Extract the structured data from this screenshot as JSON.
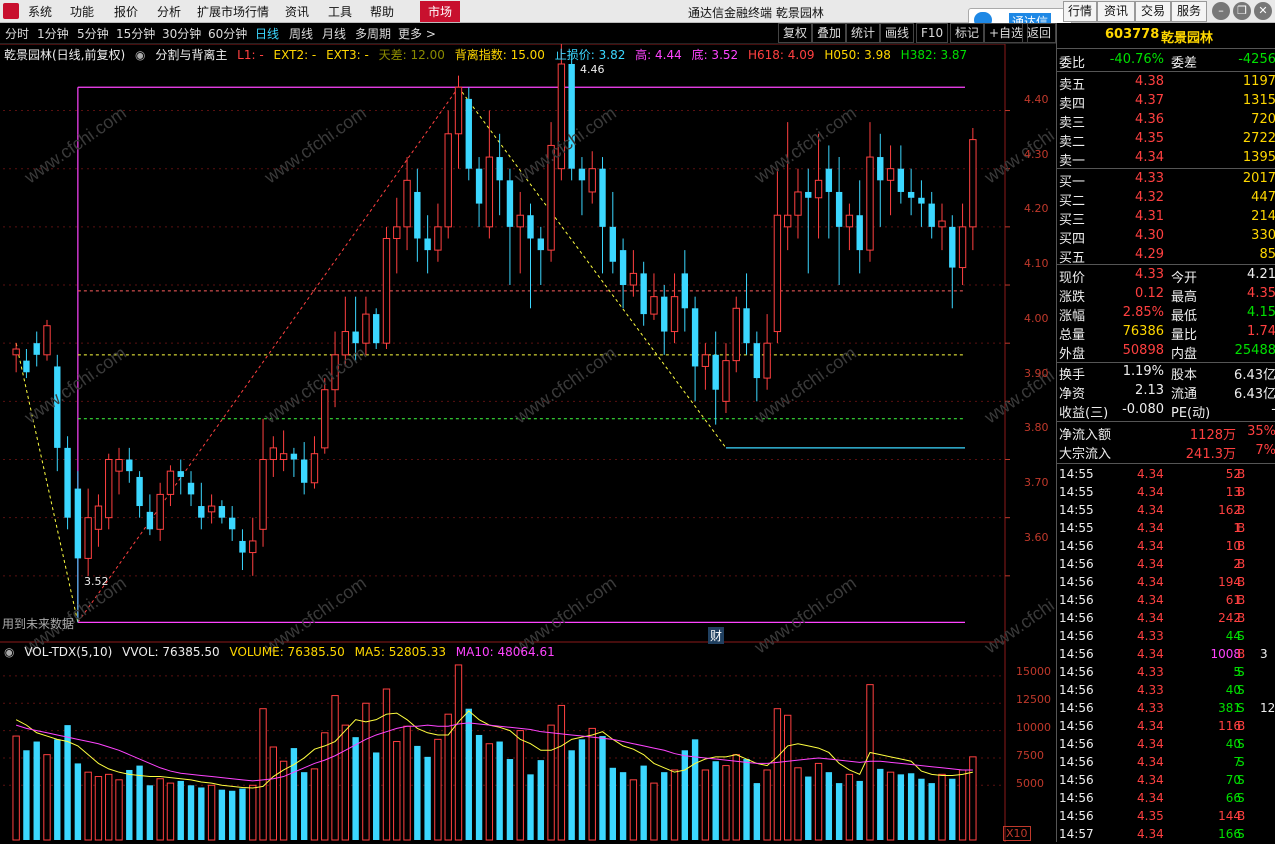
{
  "menu": {
    "items": [
      "系统",
      "功能",
      "报价",
      "分析",
      "扩展市场行情",
      "资讯",
      "工具",
      "帮助"
    ],
    "market": "市场",
    "title": "通达信金融终端  乾景园林",
    "right_buttons": [
      "行情",
      "资讯",
      "交易",
      "服务"
    ],
    "logo_text": "通达信"
  },
  "toolbar": {
    "periods": [
      "分时",
      "1分钟",
      "5分钟",
      "15分钟",
      "30分钟",
      "60分钟",
      "日线",
      "周线",
      "月线",
      "多周期",
      "更多 >"
    ],
    "active": "日线",
    "right": [
      "复权",
      "叠加",
      "统计",
      "画线",
      "F10",
      "标记",
      "+自选",
      "返回"
    ]
  },
  "main_info": {
    "name": "乾景园林(日线,前复权)",
    "indicator": "分割与背离主",
    "L1": "L1: -",
    "EXT2": "EXT2: -",
    "EXT3": "EXT3: -",
    "tiancha": "天差: 12.00",
    "beili": "背离指数: 15.00",
    "zhisun": "止损价: 3.82",
    "high": "高: 4.44",
    "low": "底: 3.52",
    "h618": "H618: 4.09",
    "h050": "H050: 3.98",
    "h382": "H382: 3.87"
  },
  "vol_info": {
    "name": "VOL-TDX(5,10)",
    "vvol": "VVOL: 76385.50",
    "volume": "VOLUME: 76385.50",
    "ma5": "MA5: 52805.33",
    "ma10": "MA10: 48064.61"
  },
  "chart_labels": {
    "peak": "4.46",
    "trough": "3.52",
    "future": "用到未来数据",
    "cai": "财",
    "x10": "X10"
  },
  "price_axis": [
    "4.40",
    "4.30",
    "4.20",
    "4.10",
    "4.00",
    "3.90",
    "3.80",
    "3.70",
    "3.60"
  ],
  "vol_axis": [
    "15000",
    "12500",
    "10000",
    "7500",
    "5000"
  ],
  "watermark": "www.cfchi.com",
  "quote": {
    "code": "603778",
    "name": "乾景园林",
    "weibi_label": "委比",
    "weibi": "-40.76%",
    "weicha_label": "委差",
    "weicha": "-4256",
    "sells": [
      {
        "label": "卖五",
        "price": "4.38",
        "vol": "1197"
      },
      {
        "label": "卖四",
        "price": "4.37",
        "vol": "1315"
      },
      {
        "label": "卖三",
        "price": "4.36",
        "vol": "720"
      },
      {
        "label": "卖二",
        "price": "4.35",
        "vol": "2722"
      },
      {
        "label": "卖一",
        "price": "4.34",
        "vol": "1395"
      }
    ],
    "buys": [
      {
        "label": "买一",
        "price": "4.33",
        "vol": "2017"
      },
      {
        "label": "买二",
        "price": "4.32",
        "vol": "447"
      },
      {
        "label": "买三",
        "price": "4.31",
        "vol": "214"
      },
      {
        "label": "买四",
        "price": "4.30",
        "vol": "330"
      },
      {
        "label": "买五",
        "price": "4.29",
        "vol": "85"
      }
    ],
    "stats": [
      {
        "l1": "现价",
        "v1": "4.33",
        "c1": "red",
        "l2": "今开",
        "v2": "4.21",
        "c2": "white"
      },
      {
        "l1": "涨跌",
        "v1": "0.12",
        "c1": "red",
        "l2": "最高",
        "v2": "4.35",
        "c2": "red"
      },
      {
        "l1": "涨幅",
        "v1": "2.85%",
        "c1": "red",
        "l2": "最低",
        "v2": "4.15",
        "c2": "green"
      },
      {
        "l1": "总量",
        "v1": "76386",
        "c1": "yellow",
        "l2": "量比",
        "v2": "1.74",
        "c2": "red"
      },
      {
        "l1": "外盘",
        "v1": "50898",
        "c1": "red",
        "l2": "内盘",
        "v2": "25488",
        "c2": "green"
      }
    ],
    "stats2": [
      {
        "l1": "换手",
        "v1": "1.19%",
        "l2": "股本",
        "v2": "6.43亿"
      },
      {
        "l1": "净资",
        "v1": "2.13",
        "l2": "流通",
        "v2": "6.43亿"
      },
      {
        "l1": "收益(三)",
        "v1": "-0.080",
        "l2": "PE(动)",
        "v2": "-"
      }
    ],
    "flow": [
      {
        "label": "净流入额",
        "v": "1128万",
        "p": "35%"
      },
      {
        "label": "大宗流入",
        "v": "241.3万",
        "p": "7%"
      }
    ],
    "ticks": [
      {
        "t": "14:55",
        "p": "4.34",
        "v": "52",
        "s": "B"
      },
      {
        "t": "14:55",
        "p": "4.34",
        "v": "13",
        "s": "B"
      },
      {
        "t": "14:55",
        "p": "4.34",
        "v": "162",
        "s": "B"
      },
      {
        "t": "14:55",
        "p": "4.34",
        "v": "1",
        "s": "B"
      },
      {
        "t": "14:56",
        "p": "4.34",
        "v": "10",
        "s": "B"
      },
      {
        "t": "14:56",
        "p": "4.34",
        "v": "2",
        "s": "B"
      },
      {
        "t": "14:56",
        "p": "4.34",
        "v": "194",
        "s": "B"
      },
      {
        "t": "14:56",
        "p": "4.34",
        "v": "61",
        "s": "B"
      },
      {
        "t": "14:56",
        "p": "4.34",
        "v": "242",
        "s": "B"
      },
      {
        "t": "14:56",
        "p": "4.33",
        "v": "44",
        "s": "S"
      },
      {
        "t": "14:56",
        "p": "4.34",
        "v": "1008",
        "s": "B"
      },
      {
        "t": "14:56",
        "p": "4.33",
        "v": "5",
        "s": "S"
      },
      {
        "t": "14:56",
        "p": "4.33",
        "v": "40",
        "s": "S"
      },
      {
        "t": "14:56",
        "p": "4.33",
        "v": "381",
        "s": "S"
      },
      {
        "t": "14:56",
        "p": "4.34",
        "v": "116",
        "s": "B"
      },
      {
        "t": "14:56",
        "p": "4.34",
        "v": "40",
        "s": "S"
      },
      {
        "t": "14:56",
        "p": "4.34",
        "v": "7",
        "s": "S"
      },
      {
        "t": "14:56",
        "p": "4.34",
        "v": "70",
        "s": "S"
      },
      {
        "t": "14:56",
        "p": "4.34",
        "v": "66",
        "s": "S"
      },
      {
        "t": "14:56",
        "p": "4.35",
        "v": "144",
        "s": "B"
      },
      {
        "t": "14:57",
        "p": "4.34",
        "v": "166",
        "s": "S"
      }
    ],
    "tick_extra": [
      "",
      "",
      "",
      "",
      "",
      "",
      "",
      "",
      "",
      "",
      "3",
      "",
      "",
      "12",
      "",
      "",
      "",
      "",
      "",
      "",
      ""
    ]
  },
  "chart_data": {
    "type": "candlestick",
    "price_range": [
      3.5,
      4.48
    ],
    "levels": {
      "top": 4.44,
      "bottom": 3.52,
      "h618": 4.09,
      "h050": 3.98,
      "h382": 3.87,
      "stop": 3.82
    },
    "candles": [
      [
        3.98,
        3.99,
        3.95,
        4.0
      ],
      [
        3.97,
        3.95,
        3.94,
        3.99
      ],
      [
        4.0,
        3.98,
        3.96,
        4.02
      ],
      [
        3.98,
        4.03,
        3.97,
        4.04
      ],
      [
        3.96,
        3.82,
        3.78,
        3.98
      ],
      [
        3.82,
        3.7,
        3.68,
        3.84
      ],
      [
        3.75,
        3.63,
        3.52,
        3.78
      ],
      [
        3.63,
        3.7,
        3.6,
        3.75
      ],
      [
        3.68,
        3.72,
        3.65,
        3.74
      ],
      [
        3.7,
        3.8,
        3.68,
        3.81
      ],
      [
        3.78,
        3.8,
        3.74,
        3.82
      ],
      [
        3.8,
        3.78,
        3.76,
        3.82
      ],
      [
        3.77,
        3.72,
        3.7,
        3.78
      ],
      [
        3.71,
        3.68,
        3.67,
        3.74
      ],
      [
        3.68,
        3.74,
        3.66,
        3.76
      ],
      [
        3.74,
        3.78,
        3.72,
        3.79
      ],
      [
        3.78,
        3.77,
        3.74,
        3.8
      ],
      [
        3.76,
        3.74,
        3.72,
        3.78
      ],
      [
        3.72,
        3.7,
        3.68,
        3.76
      ],
      [
        3.71,
        3.72,
        3.69,
        3.74
      ],
      [
        3.72,
        3.7,
        3.69,
        3.73
      ],
      [
        3.7,
        3.68,
        3.66,
        3.72
      ],
      [
        3.66,
        3.64,
        3.61,
        3.68
      ],
      [
        3.64,
        3.66,
        3.6,
        3.7
      ],
      [
        3.68,
        3.8,
        3.65,
        3.87
      ],
      [
        3.8,
        3.82,
        3.77,
        3.84
      ],
      [
        3.8,
        3.81,
        3.78,
        3.85
      ],
      [
        3.81,
        3.8,
        3.77,
        3.82
      ],
      [
        3.8,
        3.76,
        3.74,
        3.83
      ],
      [
        3.76,
        3.81,
        3.75,
        3.84
      ],
      [
        3.82,
        3.92,
        3.81,
        3.94
      ],
      [
        3.92,
        3.98,
        3.89,
        4.02
      ],
      [
        3.98,
        4.02,
        3.96,
        4.08
      ],
      [
        4.02,
        4.0,
        3.97,
        4.08
      ],
      [
        4.0,
        4.05,
        3.98,
        4.08
      ],
      [
        4.05,
        4.0,
        3.99,
        4.06
      ],
      [
        4.0,
        4.18,
        3.99,
        4.2
      ],
      [
        4.18,
        4.2,
        4.12,
        4.25
      ],
      [
        4.2,
        4.28,
        4.16,
        4.32
      ],
      [
        4.26,
        4.18,
        4.14,
        4.3
      ],
      [
        4.18,
        4.16,
        4.12,
        4.22
      ],
      [
        4.16,
        4.2,
        4.14,
        4.24
      ],
      [
        4.2,
        4.36,
        4.18,
        4.4
      ],
      [
        4.36,
        4.44,
        4.3,
        4.46
      ],
      [
        4.42,
        4.3,
        4.28,
        4.44
      ],
      [
        4.3,
        4.24,
        4.2,
        4.32
      ],
      [
        4.2,
        4.32,
        4.18,
        4.4
      ],
      [
        4.32,
        4.28,
        4.22,
        4.36
      ],
      [
        4.28,
        4.2,
        4.1,
        4.3
      ],
      [
        4.2,
        4.22,
        4.12,
        4.26
      ],
      [
        4.22,
        4.18,
        4.06,
        4.24
      ],
      [
        4.18,
        4.16,
        4.1,
        4.2
      ],
      [
        4.16,
        4.34,
        4.14,
        4.38
      ],
      [
        4.3,
        4.48,
        4.28,
        4.52
      ],
      [
        4.48,
        4.3,
        4.28,
        4.5
      ],
      [
        4.3,
        4.28,
        4.22,
        4.32
      ],
      [
        4.26,
        4.3,
        4.24,
        4.33
      ],
      [
        4.3,
        4.2,
        4.12,
        4.32
      ],
      [
        4.2,
        4.14,
        4.12,
        4.26
      ],
      [
        4.16,
        4.1,
        4.06,
        4.18
      ],
      [
        4.1,
        4.12,
        4.08,
        4.16
      ],
      [
        4.12,
        4.05,
        4.03,
        4.14
      ],
      [
        4.05,
        4.08,
        4.04,
        4.12
      ],
      [
        4.08,
        4.02,
        3.98,
        4.1
      ],
      [
        4.02,
        4.08,
        4.0,
        4.12
      ],
      [
        4.12,
        4.06,
        4.02,
        4.16
      ],
      [
        4.06,
        3.96,
        3.9,
        4.08
      ],
      [
        3.96,
        3.98,
        3.92,
        4.0
      ],
      [
        3.98,
        3.92,
        3.86,
        4.02
      ],
      [
        3.9,
        3.97,
        3.88,
        4.0
      ],
      [
        3.97,
        4.06,
        3.95,
        4.08
      ],
      [
        4.06,
        4.0,
        3.98,
        4.12
      ],
      [
        4.0,
        3.94,
        3.9,
        4.02
      ],
      [
        3.94,
        4.0,
        3.92,
        4.05
      ],
      [
        4.02,
        4.22,
        4.0,
        4.3
      ],
      [
        4.2,
        4.22,
        4.16,
        4.38
      ],
      [
        4.22,
        4.26,
        4.18,
        4.3
      ],
      [
        4.26,
        4.25,
        4.12,
        4.3
      ],
      [
        4.25,
        4.28,
        4.18,
        4.36
      ],
      [
        4.3,
        4.26,
        4.18,
        4.34
      ],
      [
        4.26,
        4.2,
        4.1,
        4.32
      ],
      [
        4.2,
        4.22,
        4.16,
        4.24
      ],
      [
        4.22,
        4.16,
        4.12,
        4.28
      ],
      [
        4.16,
        4.32,
        4.14,
        4.38
      ],
      [
        4.32,
        4.28,
        4.2,
        4.36
      ],
      [
        4.28,
        4.3,
        4.22,
        4.34
      ],
      [
        4.3,
        4.26,
        4.24,
        4.34
      ],
      [
        4.26,
        4.25,
        4.22,
        4.3
      ],
      [
        4.25,
        4.24,
        4.2,
        4.28
      ],
      [
        4.24,
        4.2,
        4.18,
        4.26
      ],
      [
        4.2,
        4.21,
        4.16,
        4.24
      ],
      [
        4.2,
        4.13,
        4.06,
        4.22
      ],
      [
        4.13,
        4.2,
        4.1,
        4.24
      ],
      [
        4.2,
        4.35,
        4.16,
        4.37
      ]
    ],
    "volume": [
      9500,
      8200,
      9000,
      7800,
      9200,
      10500,
      7000,
      6200,
      5800,
      6000,
      5500,
      6400,
      6800,
      5000,
      5600,
      5200,
      5400,
      5000,
      4800,
      5000,
      4600,
      4500,
      4700,
      5000,
      12000,
      8500,
      7200,
      8400,
      6200,
      6500,
      9800,
      13200,
      10500,
      9400,
      12500,
      8000,
      13800,
      9000,
      10400,
      8600,
      7600,
      9200,
      11500,
      16000,
      12000,
      9600,
      8800,
      9000,
      7400,
      10000,
      6000,
      7300,
      10500,
      12300,
      8200,
      9200,
      10200,
      9500,
      6600,
      6200,
      5500,
      6800,
      5200,
      6200,
      6400,
      8200,
      9200,
      6400,
      7200,
      6800,
      7800,
      7400,
      5200,
      6400,
      12000,
      11400,
      6600,
      5800,
      7000,
      6200,
      5200,
      6000,
      5400,
      14200,
      6500,
      6200,
      6000,
      6100,
      5600,
      5200,
      6000,
      5600,
      6400,
      7600
    ],
    "ma5": [
      11000,
      10500,
      9800,
      9500,
      9200,
      9000,
      8600,
      7800,
      7000,
      6500,
      6200,
      6000,
      5900,
      5800,
      5800,
      5700,
      5600,
      5500,
      5300,
      5200,
      5000,
      4900,
      4800,
      4750,
      4900,
      5800,
      6400,
      6900,
      7500,
      8300,
      8600,
      9000,
      10000,
      11000,
      10800,
      11000,
      11500,
      11600,
      11000,
      10200,
      9800,
      9600,
      9600,
      10800,
      11800,
      11000,
      10500,
      10300,
      10000,
      9200,
      8800,
      8200,
      8200,
      8600,
      9200,
      9400,
      9600,
      9900,
      9200,
      8600,
      8300,
      7800,
      7000,
      6600,
      6200,
      6400,
      7000,
      7400,
      7600,
      7600,
      7800,
      7400,
      7000,
      6800,
      7600,
      8600,
      8800,
      8600,
      8400,
      8000,
      7000,
      6400,
      6000,
      8000,
      7800,
      7600,
      7400,
      7200,
      6300,
      6000,
      5900,
      5900,
      6000,
      6200
    ],
    "ma10": [
      10500,
      10200,
      10000,
      9800,
      9600,
      9400,
      9200,
      9000,
      8800,
      8500,
      8200,
      7800,
      7400,
      7000,
      6600,
      6300,
      6100,
      6000,
      5900,
      5800,
      5700,
      5600,
      5500,
      5400,
      5500,
      5600,
      5800,
      6200,
      6600,
      7000,
      7300,
      7700,
      8200,
      8700,
      9200,
      9600,
      9900,
      10200,
      10400,
      10400,
      10500,
      10400,
      10400,
      10600,
      10700,
      10600,
      10500,
      10400,
      10300,
      10200,
      10100,
      9900,
      9800,
      9700,
      9600,
      9500,
      9400,
      9300,
      9200,
      9000,
      8800,
      8600,
      8400,
      8200,
      7900,
      7700,
      7600,
      7500,
      7400,
      7300,
      7200,
      7100,
      7000,
      7000,
      7100,
      7200,
      7300,
      7400,
      7500,
      7400,
      7300,
      7200,
      7100,
      7200,
      7200,
      7100,
      7000,
      6900,
      6800,
      6700,
      6600,
      6500,
      6400,
      6400
    ]
  }
}
